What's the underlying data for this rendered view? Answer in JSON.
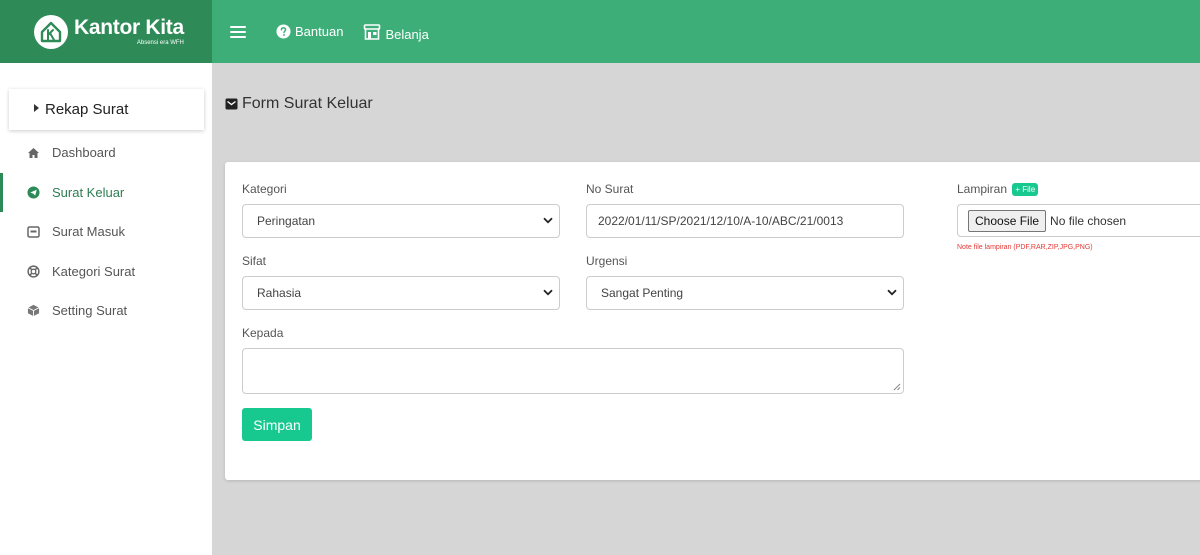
{
  "brand": {
    "title": "Kantor Kita",
    "subtitle": "Absensi era WFH"
  },
  "topbar": {
    "bantuan": "Bantuan",
    "belanja": "Belanja"
  },
  "sidebar": {
    "rekap": "Rekap Surat",
    "items": [
      {
        "label": "Dashboard",
        "icon": "home-icon"
      },
      {
        "label": "Surat Keluar",
        "icon": "send-icon"
      },
      {
        "label": "Surat Masuk",
        "icon": "inbox-icon"
      },
      {
        "label": "Kategori Surat",
        "icon": "lifebuoy-icon"
      },
      {
        "label": "Setting Surat",
        "icon": "box-icon"
      }
    ]
  },
  "page": {
    "title": "Form Surat Keluar"
  },
  "form": {
    "kategori_label": "Kategori",
    "kategori_value": "Peringatan",
    "no_surat_label": "No Surat",
    "no_surat_value": "2022/01/11/SP/2021/12/10/A-10/ABC/21/0013",
    "sifat_label": "Sifat",
    "sifat_value": "Rahasia",
    "urgensi_label": "Urgensi",
    "urgensi_value": "Sangat Penting",
    "kepada_label": "Kepada",
    "kepada_value": "",
    "lampiran_label": "Lampiran",
    "add_file": "+ File",
    "choose_file": "Choose File",
    "no_file": "No file chosen",
    "note": "Note file lampiran (PDF,RAR,ZIP,JPG,PNG)",
    "submit": "Simpan"
  },
  "colors": {
    "brand_dark": "#2e8b57",
    "topbar": "#3eae79",
    "accent": "#17c98f",
    "note": "#e53935"
  }
}
